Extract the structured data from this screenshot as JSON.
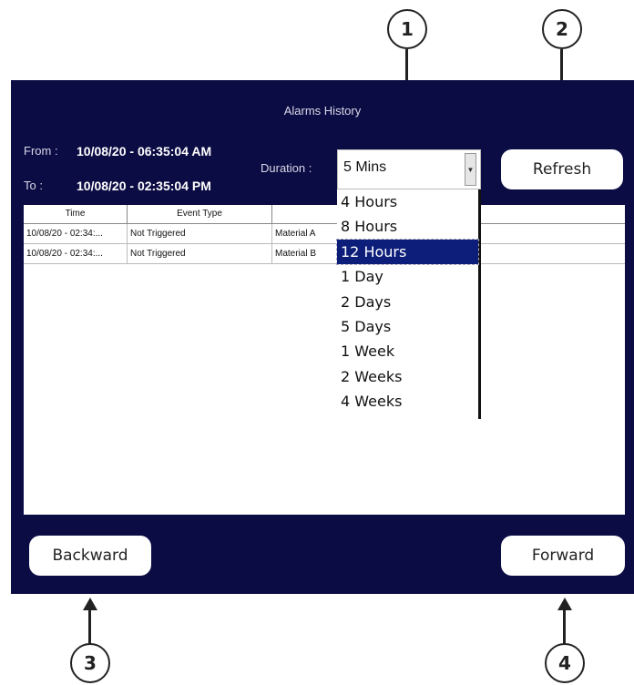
{
  "callouts": [
    "1",
    "2",
    "3",
    "4"
  ],
  "window": {
    "title": "Alarms History"
  },
  "range": {
    "from_label": "From :",
    "from_value": "10/08/20 - 06:35:04 AM",
    "to_label": "To :",
    "to_value": "10/08/20 - 02:35:04 PM"
  },
  "duration": {
    "label": "Duration :",
    "selected": "5 Mins",
    "options": [
      "4 Hours",
      "8 Hours",
      "12 Hours",
      "1 Day",
      "2 Days",
      "5 Days",
      "1 Week",
      "2 Weeks",
      "4 Weeks"
    ],
    "highlighted": "12 Hours"
  },
  "buttons": {
    "refresh": "Refresh",
    "backward": "Backward",
    "forward": "Forward"
  },
  "table": {
    "headers": [
      "Time",
      "Event Type",
      ""
    ],
    "rows": [
      [
        "10/08/20 - 02:34:...",
        "Not Triggered",
        "Material A"
      ],
      [
        "10/08/20 - 02:34:...",
        "Not Triggered",
        "Material B"
      ]
    ]
  },
  "colors": {
    "panel_bg": "#0c0c44",
    "highlight": "#0d1e7a"
  },
  "icons": {
    "dropdown": "chevron-down-icon"
  }
}
